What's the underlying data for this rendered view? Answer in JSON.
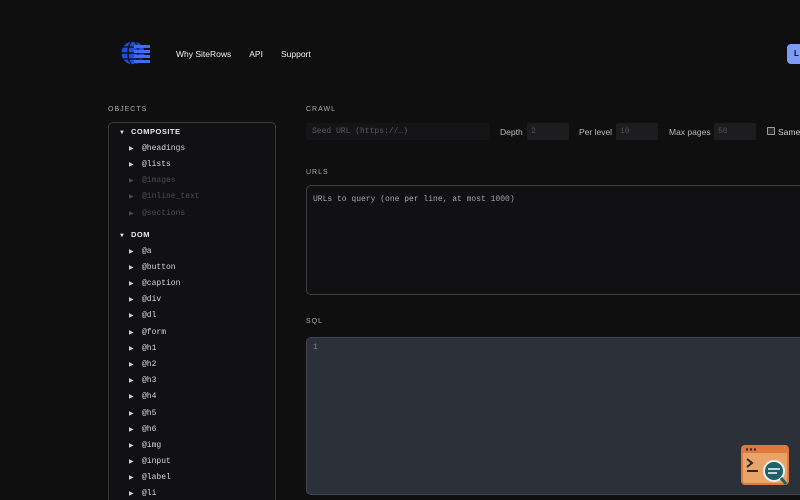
{
  "header": {
    "nav": [
      "Why SiteRows",
      "API",
      "Support"
    ],
    "cta_label": "L"
  },
  "objects": {
    "section_label": "OBJECTS",
    "groups": [
      {
        "name": "COMPOSITE",
        "items": [
          {
            "label": "@headings",
            "enabled": true
          },
          {
            "label": "@lists",
            "enabled": true
          },
          {
            "label": "@images",
            "enabled": false
          },
          {
            "label": "@inline_text",
            "enabled": false
          },
          {
            "label": "@sections",
            "enabled": false
          }
        ]
      },
      {
        "name": "DOM",
        "items": [
          {
            "label": "@a",
            "enabled": true
          },
          {
            "label": "@button",
            "enabled": true
          },
          {
            "label": "@caption",
            "enabled": true
          },
          {
            "label": "@div",
            "enabled": true
          },
          {
            "label": "@dl",
            "enabled": true
          },
          {
            "label": "@form",
            "enabled": true
          },
          {
            "label": "@h1",
            "enabled": true
          },
          {
            "label": "@h2",
            "enabled": true
          },
          {
            "label": "@h3",
            "enabled": true
          },
          {
            "label": "@h4",
            "enabled": true
          },
          {
            "label": "@h5",
            "enabled": true
          },
          {
            "label": "@h6",
            "enabled": true
          },
          {
            "label": "@img",
            "enabled": true
          },
          {
            "label": "@input",
            "enabled": true
          },
          {
            "label": "@label",
            "enabled": true
          },
          {
            "label": "@li",
            "enabled": true
          }
        ]
      }
    ]
  },
  "crawl": {
    "section_label": "CRAWL",
    "seed_placeholder": "Seed URL (https://…)",
    "depth_label": "Depth",
    "depth_value": "2",
    "per_level_label": "Per level",
    "per_level_value": "10",
    "max_pages_label": "Max pages",
    "max_pages_value": "50",
    "same_label": "Same"
  },
  "urls": {
    "section_label": "URLS",
    "placeholder": "URLs to query (one per line, at most 1000)"
  },
  "sql": {
    "section_label": "SQL",
    "line_number": "1"
  },
  "colors": {
    "background": "#0f0f10",
    "accent": "#7d9cf7",
    "widget": "#e07a3c"
  },
  "icons": {
    "logo": "globe-grid-icon",
    "widget": "terminal-search-icon"
  }
}
